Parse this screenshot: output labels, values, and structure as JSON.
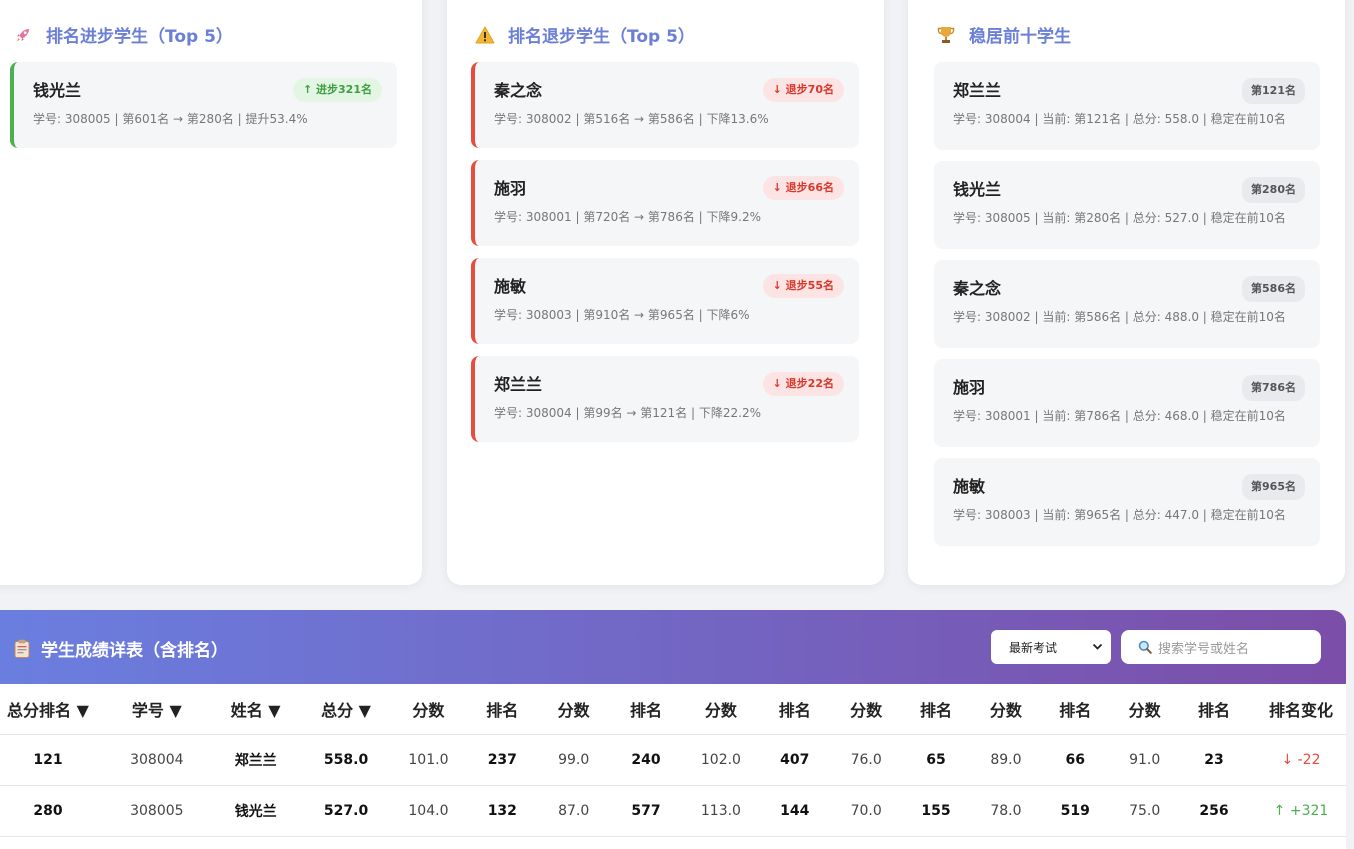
{
  "improve_panel": {
    "title": "排名进步学生（Top 5）",
    "icon": "rocket-icon",
    "cards": [
      {
        "name": "钱光兰",
        "badge": "↑ 进步321名",
        "info": "学号: 308005 | 第601名 → 第280名 | 提升53.4%"
      }
    ]
  },
  "decline_panel": {
    "title": "排名退步学生（Top 5）",
    "icon": "warning-icon",
    "cards": [
      {
        "name": "秦之念",
        "badge": "↓ 退步70名",
        "info": "学号: 308002 | 第516名 → 第586名 | 下降13.6%"
      },
      {
        "name": "施羽",
        "badge": "↓ 退步66名",
        "info": "学号: 308001 | 第720名 → 第786名 | 下降9.2%"
      },
      {
        "name": "施敏",
        "badge": "↓ 退步55名",
        "info": "学号: 308003 | 第910名 → 第965名 | 下降6%"
      },
      {
        "name": "郑兰兰",
        "badge": "↓ 退步22名",
        "info": "学号: 308004 | 第99名 → 第121名 | 下降22.2%"
      }
    ]
  },
  "stable_panel": {
    "title": "稳居前十学生",
    "icon": "trophy-icon",
    "cards": [
      {
        "name": "郑兰兰",
        "badge": "第121名",
        "info": "学号: 308004 | 当前: 第121名 | 总分: 558.0 | 稳定在前10名"
      },
      {
        "name": "钱光兰",
        "badge": "第280名",
        "info": "学号: 308005 | 当前: 第280名 | 总分: 527.0 | 稳定在前10名"
      },
      {
        "name": "秦之念",
        "badge": "第586名",
        "info": "学号: 308002 | 当前: 第586名 | 总分: 488.0 | 稳定在前10名"
      },
      {
        "name": "施羽",
        "badge": "第786名",
        "info": "学号: 308001 | 当前: 第786名 | 总分: 468.0 | 稳定在前10名"
      },
      {
        "name": "施敏",
        "badge": "第965名",
        "info": "学号: 308003 | 当前: 第965名 | 总分: 447.0 | 稳定在前10名"
      }
    ]
  },
  "table_section": {
    "title": "学生成绩详表（含排名）",
    "icon": "clipboard-icon",
    "exam_select": {
      "selected": "最新考试"
    },
    "search": {
      "placeholder": "搜索学号或姓名",
      "value": ""
    },
    "headers": [
      "总分排名 ▼",
      "学号 ▼",
      "姓名 ▼",
      "总分 ▼",
      "分数",
      "排名",
      "分数",
      "排名",
      "分数",
      "排名",
      "分数",
      "排名",
      "分数",
      "排名",
      "分数",
      "排名",
      "排名变化"
    ],
    "rows": [
      [
        "121",
        "308004",
        "郑兰兰",
        "558.0",
        "101.0",
        "237",
        "99.0",
        "240",
        "102.0",
        "407",
        "76.0",
        "65",
        "89.0",
        "66",
        "91.0",
        "23",
        "↓ -22"
      ],
      [
        "280",
        "308005",
        "钱光兰",
        "527.0",
        "104.0",
        "132",
        "87.0",
        "577",
        "113.0",
        "144",
        "70.0",
        "155",
        "78.0",
        "519",
        "75.0",
        "256",
        "↑ +321"
      ]
    ],
    "row_change_direction": [
      "down",
      "up"
    ]
  },
  "colors": {
    "accent": "#6b7fd7",
    "up": "#4caf50",
    "down": "#e74c3c",
    "header_gradient_start": "#6a7fe0",
    "header_gradient_end": "#7b4ea8"
  }
}
